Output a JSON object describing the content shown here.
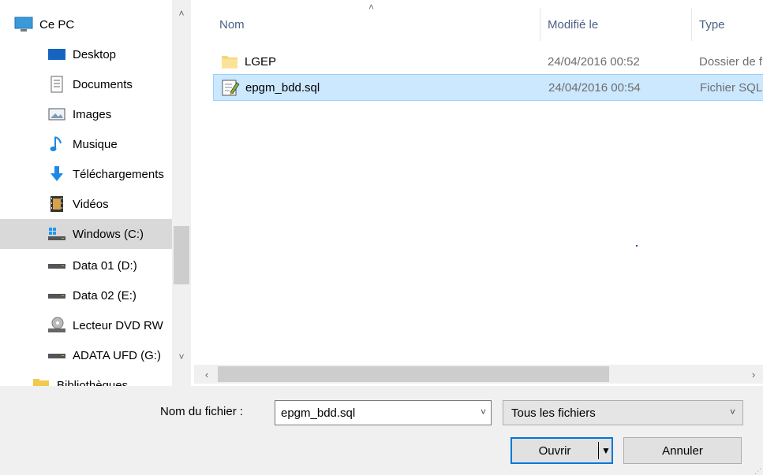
{
  "nav": {
    "items": [
      {
        "label": "Ce PC",
        "icon": "computer-icon"
      },
      {
        "label": "Desktop",
        "icon": "desktop-icon"
      },
      {
        "label": "Documents",
        "icon": "documents-icon"
      },
      {
        "label": "Images",
        "icon": "images-icon"
      },
      {
        "label": "Musique",
        "icon": "music-icon"
      },
      {
        "label": "Téléchargements",
        "icon": "download-icon"
      },
      {
        "label": "Vidéos",
        "icon": "video-icon"
      },
      {
        "label": "Windows (C:)",
        "icon": "windows-drive-icon"
      },
      {
        "label": "Data 01 (D:)",
        "icon": "drive-icon"
      },
      {
        "label": "Data 02 (E:)",
        "icon": "drive-icon"
      },
      {
        "label": "Lecteur DVD RW",
        "icon": "dvd-drive-icon"
      },
      {
        "label": "ADATA UFD (G:)",
        "icon": "usb-drive-icon"
      },
      {
        "label": "Bibliothèques",
        "icon": "libraries-icon"
      }
    ],
    "selected": "Windows (C:)"
  },
  "columns": {
    "name": "Nom",
    "modified": "Modifié le",
    "type": "Type"
  },
  "files": [
    {
      "name": "LGEP",
      "modified": "24/04/2016 00:52",
      "type": "Dossier de fichiers",
      "icon": "folder-icon"
    },
    {
      "name": "epgm_bdd.sql",
      "modified": "24/04/2016 00:54",
      "type": "Fichier SQL",
      "icon": "sql-file-icon"
    }
  ],
  "bottom": {
    "filename_label": "Nom du fichier :",
    "filename_value": "epgm_bdd.sql",
    "filetype_value": "Tous les fichiers",
    "open_label": "Ouvrir",
    "cancel_label": "Annuler"
  },
  "colors": {
    "selection_bg": "#cce8ff",
    "selection_border": "#99d1ff",
    "header_text": "#4a5f85",
    "accent": "#0078d7"
  }
}
